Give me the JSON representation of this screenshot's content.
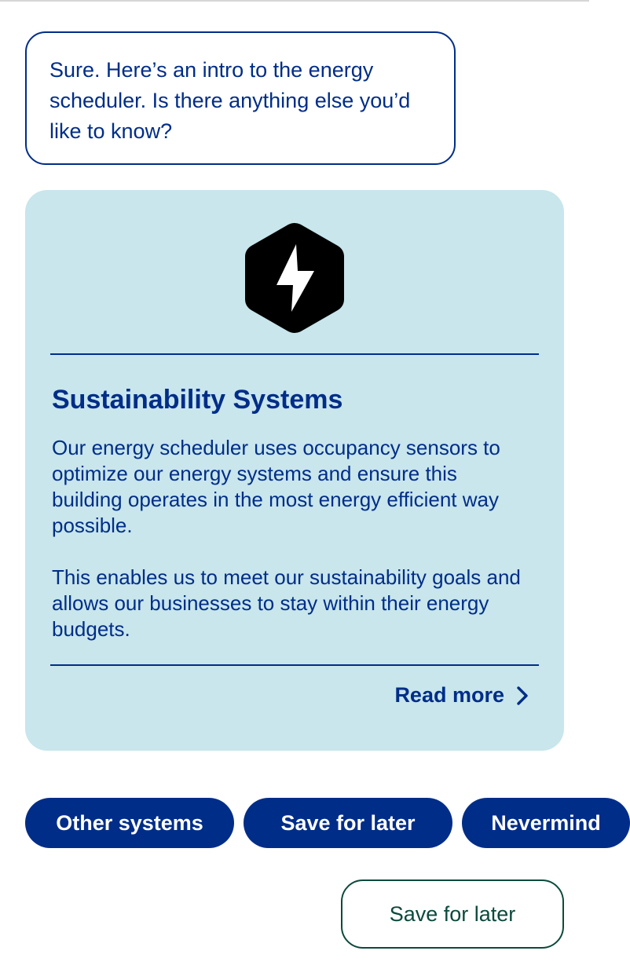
{
  "chat": {
    "message": "Sure. Here’s an intro to the energy scheduler. Is there anything else you’d like to know?"
  },
  "card": {
    "icon": "lightning-bolt-hexagon-icon",
    "title": "Sustainability Systems",
    "paragraphs": [
      "Our energy scheduler uses occupancy sensors to optimize our energy systems and ensure this building operates in the most energy efficient way possible.",
      "This enables us to meet our sustainability goals and allows our businesses to stay within their energy budgets."
    ],
    "read_more_label": "Read more",
    "read_more_icon": "chevron-right-icon"
  },
  "quick_replies": [
    {
      "label": "Other systems"
    },
    {
      "label": "Save for later"
    },
    {
      "label": "Nevermind"
    }
  ],
  "secondary_button": {
    "label": "Save for later"
  },
  "colors": {
    "primary": "#002d88",
    "card_background": "#c8e6ec",
    "secondary_outline": "#0c4a3c",
    "divider": "#d6d6d6"
  }
}
